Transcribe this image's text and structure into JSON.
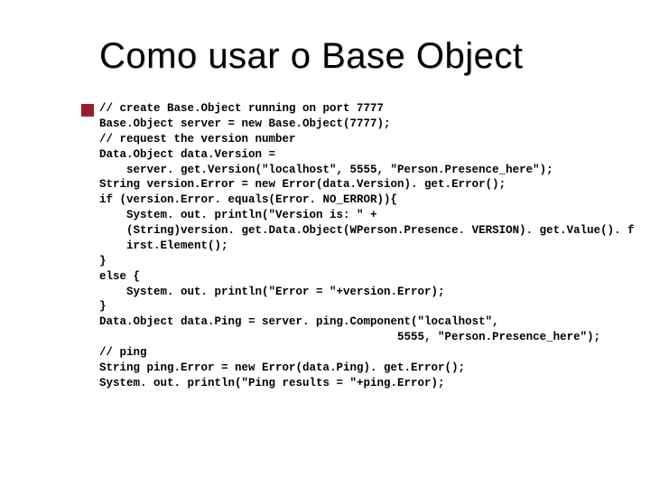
{
  "slide": {
    "title": "Como usar o Base Object",
    "code_lines": [
      "// create Base.Object running on port 7777",
      "Base.Object server = new Base.Object(7777);",
      "// request the version number",
      "Data.Object data.Version =",
      "    server. get.Version(\"localhost\", 5555, \"Person.Presence_here\");",
      "String version.Error = new Error(data.Version). get.Error();",
      "if (version.Error. equals(Error. NO_ERROR)){",
      "    System. out. println(\"Version is: \" +",
      "    (String)version. get.Data.Object(WPerson.Presence. VERSION). get.Value(). f",
      "    irst.Element();",
      "}",
      "else {",
      "    System. out. println(\"Error = \"+version.Error);",
      "}",
      "Data.Object data.Ping = server. ping.Component(\"localhost\",",
      "                                            5555, \"Person.Presence_here\");",
      "// ping",
      "String ping.Error = new Error(data.Ping). get.Error();",
      "System. out. println(\"Ping results = \"+ping.Error);"
    ]
  }
}
